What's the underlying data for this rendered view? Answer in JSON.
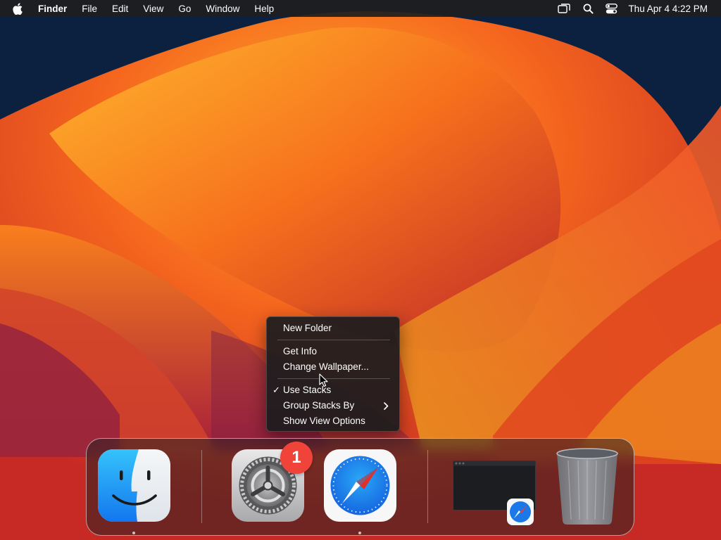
{
  "menubar": {
    "app_name": "Finder",
    "items": [
      "File",
      "Edit",
      "View",
      "Go",
      "Window",
      "Help"
    ],
    "status_icons": [
      "screen-mirroring-icon",
      "search-icon",
      "control-center-icon"
    ],
    "clock": "Thu Apr 4  4:22 PM"
  },
  "context_menu": {
    "items": [
      {
        "label": "New Folder"
      },
      {
        "label": "Get Info"
      },
      {
        "label": "Change Wallpaper..."
      },
      {
        "label": "Use Stacks",
        "checked": true
      },
      {
        "label": "Group Stacks By",
        "submenu": true
      },
      {
        "label": "Show View Options"
      }
    ],
    "check_glyph": "✓"
  },
  "dock": {
    "apps": [
      {
        "name": "finder-app-icon",
        "running": true
      },
      {
        "name": "system-settings-app-icon",
        "badge": "1",
        "running": false
      },
      {
        "name": "safari-app-icon",
        "running": true
      }
    ],
    "minimized": [
      {
        "name": "safari-minimized-window"
      }
    ],
    "trash": {
      "name": "trash-icon"
    }
  },
  "colors": {
    "wallpaper_orange": "#f5551d",
    "wallpaper_yellow": "#f9b125",
    "wallpaper_navy": "#0d2444",
    "badge_red": "#f0443a",
    "finder_blue": "#1ba8f5",
    "safari_blue": "#1679e8"
  }
}
